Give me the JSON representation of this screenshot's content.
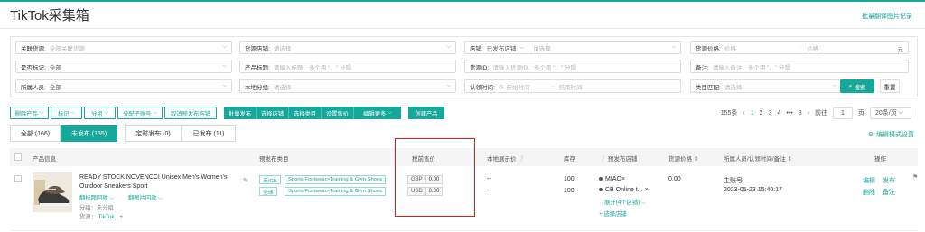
{
  "header": {
    "title": "TikTok采集箱",
    "right_link": "批量翻译图片记录"
  },
  "filters": {
    "row1": [
      {
        "label": "关联货源:",
        "placeholder": "全部关联货源"
      },
      {
        "label": "货源店铺:",
        "placeholder": "请选择"
      },
      {
        "label": "店铺:",
        "value": "已发布店铺",
        "placeholder": "请选择"
      },
      {
        "label": "货源价格:",
        "placeholder_min": "价格",
        "placeholder_max": "价格",
        "unit": "元"
      }
    ],
    "row2": [
      {
        "label": "是否标记:",
        "value": "全部"
      },
      {
        "label": "产品标题:",
        "placeholder": "请输入标题、多个用 \"、\" 分隔"
      },
      {
        "label": "货源ID:",
        "placeholder": "请输入货源ID、多个用 \"、\" 分隔"
      },
      {
        "label": "备注:",
        "placeholder": "请输入备注、多个用 \"、\" 分隔"
      }
    ],
    "row3": [
      {
        "label": "所属人员:",
        "value": "全部"
      },
      {
        "label": "本地分组:",
        "placeholder": "请选择"
      },
      {
        "label": "认领时间:",
        "placeholder_start": "开始时间",
        "placeholder_end": "结束时间"
      },
      {
        "label": "类目匹配:",
        "placeholder": "请选择"
      }
    ],
    "search_label": "搜索",
    "reset_label": "重置"
  },
  "toolbar": {
    "outline_buttons": [
      "删除产品",
      "标记",
      "分组",
      "分配子账号",
      "取消预发布店铺"
    ],
    "fill_buttons": [
      "批量发布",
      "选择店铺",
      "选择类目",
      "设置售价",
      "编辑更多"
    ],
    "create_button": "创建产品"
  },
  "pagination": {
    "total": "155条",
    "pages": [
      "1",
      "2",
      "3",
      "4",
      "•••",
      "8"
    ],
    "goto_label": "前往",
    "goto_value": "1",
    "page_suffix": "页",
    "page_size": "20条/页"
  },
  "tabs": [
    {
      "label": "全部 (166)"
    },
    {
      "label": "未发布 (155)"
    },
    {
      "label": "定时发布 (0)"
    },
    {
      "label": "已发布 (11)"
    }
  ],
  "edit_mode_label": "编辑模式设置",
  "table": {
    "headers": {
      "info": "产品信息",
      "category": "预发布类目",
      "price": "税前售价",
      "local_price": "本地展示价",
      "stock": "库存",
      "store": "预发布店铺",
      "source_price": "货源价格",
      "owner": "所属人员/认领时间/备注",
      "action": "操作"
    },
    "row": {
      "title_line1": "READY STOCK NOVENCCI Unisex Men's Women's",
      "title_line2": "Outdoor Sneakers Sport",
      "translate_title": "翻标题回款",
      "translate_image": "翻图片回款",
      "group": "分组：未分组",
      "source_label": "货源：",
      "source_value": "TikTok",
      "add": "+",
      "cats": [
        {
          "market": "英/GB",
          "path": "Sports Footwear>Training & Gym Shoes"
        },
        {
          "market": "全球",
          "path": "Sports Footwear>Training & Gym Shoes"
        }
      ],
      "prices": [
        {
          "cur": "GBP",
          "amount": "0.00"
        },
        {
          "cur": "USD",
          "amount": "0.00"
        }
      ],
      "local_prices": [
        "--",
        "--"
      ],
      "stocks": [
        "100",
        "100"
      ],
      "stores": [
        "MIAO×",
        "CB Online t... ×"
      ],
      "expand": "展开(4个店铺)",
      "select_store": "+ 选择店铺",
      "source_price": "0.00",
      "owner": "主账号",
      "time": "2023-05-23 15:40:17",
      "actions": [
        "编辑",
        "发布",
        "删除",
        "备注"
      ]
    }
  }
}
